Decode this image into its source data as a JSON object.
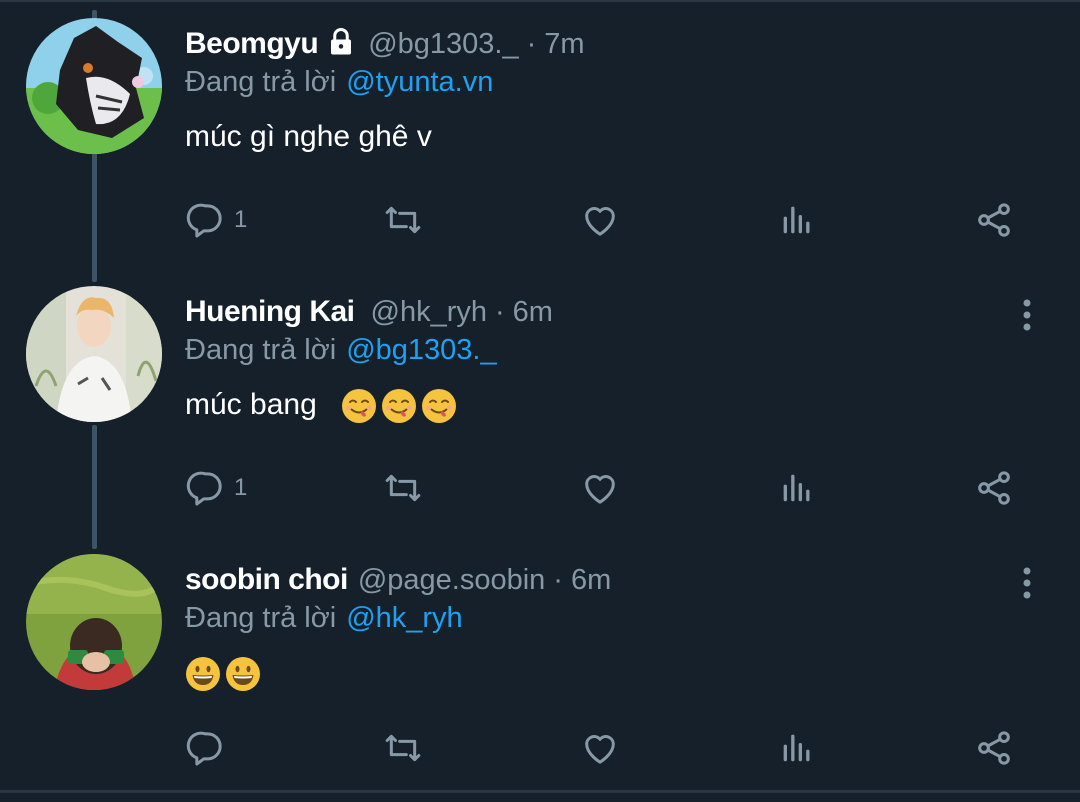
{
  "tweets": [
    {
      "name": "Beomgyu",
      "handle": "@bg1303._",
      "separator": "·",
      "time": "7m",
      "reply_prefix": "Đang trả lời",
      "reply_to": "@tyunta.vn",
      "text": "múc gì nghe ghê v",
      "emojis": [],
      "reply_count": "1",
      "locked": true
    },
    {
      "name": "Huening Kai",
      "handle": "@hk_ryh",
      "separator": "·",
      "time": "6m",
      "reply_prefix": "Đang trả lời",
      "reply_to": "@bg1303._",
      "text": "múc bang",
      "emojis": [
        "face-savoring-food",
        "face-savoring-food",
        "face-savoring-food"
      ],
      "reply_count": "1",
      "locked": false
    },
    {
      "name": "soobin choi",
      "handle": "@page.soobin",
      "separator": "·",
      "time": "6m",
      "reply_prefix": "Đang trả lời",
      "reply_to": "@hk_ryh",
      "text": "",
      "emojis": [
        "grinning-face",
        "grinning-face"
      ],
      "reply_count": "",
      "locked": false
    }
  ],
  "colors": {
    "background": "#15202b",
    "text": "#ffffff",
    "secondary": "#8899a6",
    "mention": "#1da1f2",
    "thread_line": "#3d5466"
  },
  "icons": [
    "reply-icon",
    "retweet-icon",
    "like-icon",
    "analytics-icon",
    "share-icon",
    "more-icon",
    "lock-icon"
  ]
}
